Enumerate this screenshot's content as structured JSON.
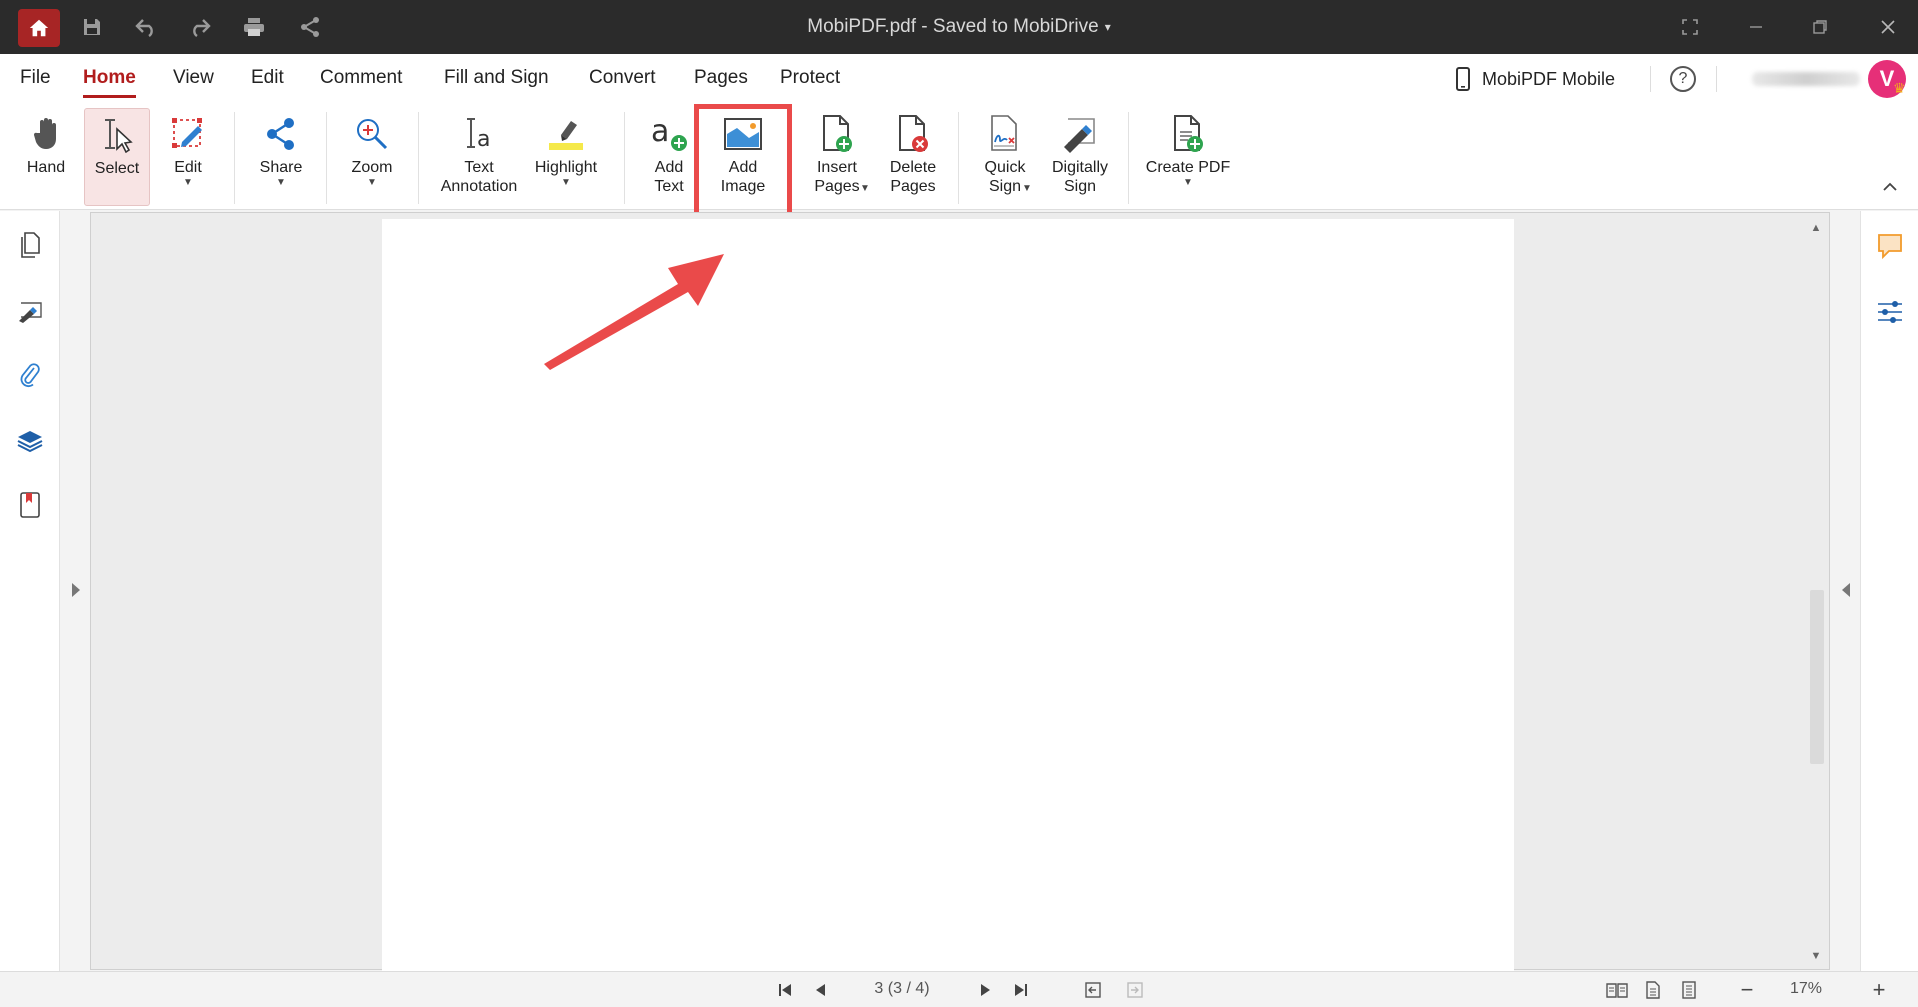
{
  "titlebar": {
    "title": "MobiPDF.pdf - Saved to MobiDrive",
    "caret": "▾"
  },
  "menu": {
    "items": [
      "File",
      "Home",
      "View",
      "Edit",
      "Comment",
      "Fill and Sign",
      "Convert",
      "Pages",
      "Protect"
    ],
    "active": "Home",
    "mobile_label": "MobiPDF Mobile",
    "help_label": "?",
    "avatar_letter": "V"
  },
  "ribbon": {
    "hand": "Hand",
    "select": "Select",
    "edit": "Edit",
    "share": "Share",
    "zoom": "Zoom",
    "text_annotation": "Text Annotation",
    "highlight": "Highlight",
    "add_text": "Add Text",
    "add_image": "Add Image",
    "insert_pages": "Insert Pages",
    "delete_pages": "Delete Pages",
    "quick_sign": "Quick Sign",
    "digitally_sign": "Digitally Sign",
    "create_pdf": "Create PDF",
    "dropdown_glyph": "▼"
  },
  "statusbar": {
    "page_indicator": "3 (3 / 4)",
    "zoom": "17%",
    "zoom_out": "−",
    "zoom_in": "+"
  },
  "colors": {
    "accent": "#b11d1d",
    "callout": "#ea4a4a",
    "titlebar": "#2b2b2b"
  }
}
